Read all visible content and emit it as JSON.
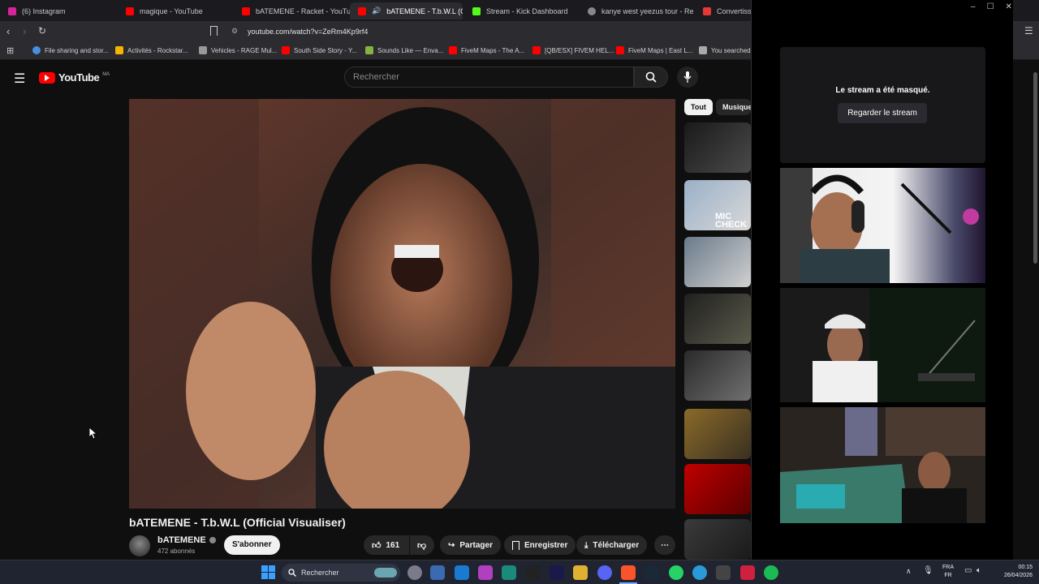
{
  "browser": {
    "tabs": [
      {
        "label": "(6) Instagram",
        "color": "#d6249f"
      },
      {
        "label": "magique - YouTube",
        "color": "#ff0000"
      },
      {
        "label": "bATEMENE - Racket - YouTube",
        "color": "#ff0000"
      },
      {
        "label": "bATEMENE - T.b.W.L (O",
        "color": "#ff0000",
        "active": true
      },
      {
        "label": "Stream - Kick Dashboard",
        "color": "#53fc18"
      },
      {
        "label": "kanye west yeezus tour - Reche",
        "color": "#888888"
      },
      {
        "label": "Convertisseu",
        "color": "#e53935"
      }
    ],
    "url": "youtube.com/watch?v=ZeRm4Kp9rf4",
    "bookmarks": [
      "File sharing and stor...",
      "Activités - Rockstar...",
      "Vehicles - RAGE Mul...",
      "South Side Story - Y...",
      "Sounds Like — Enva...",
      "FiveM Maps - The A...",
      "[QB/ESX] FIVEM HEL...",
      "FiveM Maps | East L...",
      "You searched f"
    ]
  },
  "youtube": {
    "logo_text": "YouTube",
    "region": "MA",
    "search_placeholder": "Rechercher",
    "chips": [
      "Tout",
      "Musique"
    ],
    "video_title": "bATEMENE - T.b.W.L (Official Visualiser)",
    "channel_name": "bATEMENE",
    "subscribers": "472 abonnés",
    "subscribe_label": "S'abonner",
    "likes": "161",
    "share_label": "Partager",
    "save_label": "Enregistrer",
    "download_label": "Télécharger",
    "rec_mic_text": "MIC CHECK"
  },
  "kick": {
    "hidden_message": "Le stream a été masqué.",
    "watch_label": "Regarder le stream"
  },
  "taskbar": {
    "search_label": "Rechercher",
    "lang_top": "FRA",
    "lang_bottom": "FR",
    "time": "00:15",
    "date": "26/04/2026"
  },
  "colors": {
    "youtube_red": "#ff0000",
    "kick_green": "#53fc18",
    "panel_bg": "#18181b"
  }
}
